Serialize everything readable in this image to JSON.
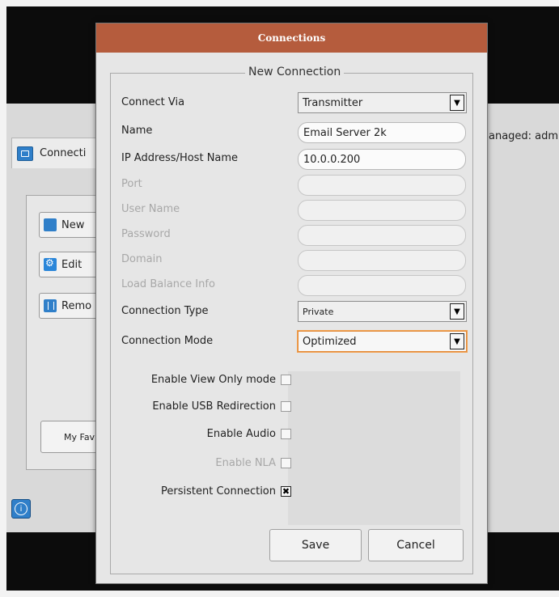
{
  "background": {
    "tab_label": "Connecti",
    "managed_text": "anaged: adm",
    "buttons": {
      "new": "New",
      "edit": "Edit",
      "remove": "Remo"
    },
    "favorites_label": "My Fav"
  },
  "dialog": {
    "title": "Connections",
    "group_title": "New Connection",
    "fields": {
      "connect_via": {
        "label": "Connect Via",
        "value": "Transmitter"
      },
      "name": {
        "label": "Name",
        "value": "Email Server 2k"
      },
      "ip": {
        "label": "IP Address/Host Name",
        "value": "10.0.0.200"
      },
      "port": {
        "label": "Port",
        "value": ""
      },
      "user_name": {
        "label": "User Name",
        "value": ""
      },
      "password": {
        "label": "Password",
        "value": ""
      },
      "domain": {
        "label": "Domain",
        "value": ""
      },
      "load_balance": {
        "label": "Load Balance Info",
        "value": ""
      },
      "connection_type": {
        "label": "Connection Type",
        "value": "Private"
      },
      "connection_mode": {
        "label": "Connection Mode",
        "value": "Optimized"
      }
    },
    "checkboxes": {
      "view_only": {
        "label": "Enable View Only mode",
        "checked": false
      },
      "usb": {
        "label": "Enable USB Redirection",
        "checked": false
      },
      "audio": {
        "label": "Enable Audio",
        "checked": false
      },
      "nla": {
        "label": "Enable NLA",
        "checked": false
      },
      "persistent": {
        "label": "Persistent Connection",
        "checked": true
      }
    },
    "buttons": {
      "save": "Save",
      "cancel": "Cancel"
    }
  },
  "colors": {
    "titlebar": "#b55c3d",
    "focus": "#e38b3a",
    "disabled_text": "#a8a8a8"
  }
}
